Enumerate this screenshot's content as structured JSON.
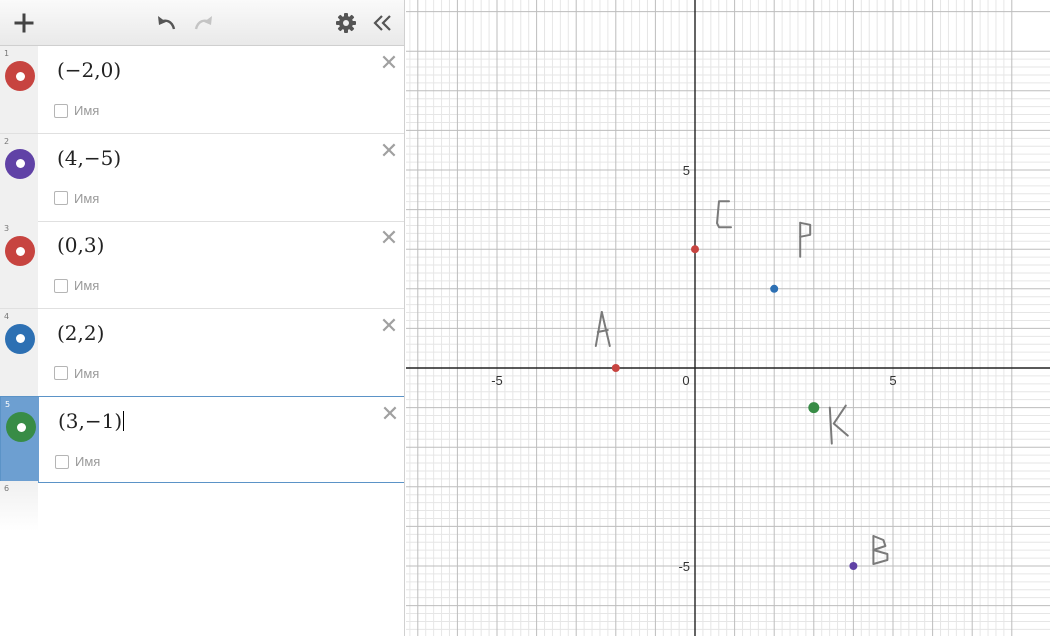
{
  "toolbar": {
    "add_icon": "plus-icon",
    "undo_icon": "undo-icon",
    "redo_icon": "redo-icon",
    "settings_icon": "gear-icon",
    "collapse_icon": "double-chevron-left-icon"
  },
  "expressions": [
    {
      "index": "1",
      "latex": "(−2,0)",
      "color": "#c74440",
      "label": "Имя"
    },
    {
      "index": "2",
      "latex": "(4,−5)",
      "color": "#6042a6",
      "label": "Имя"
    },
    {
      "index": "3",
      "latex": "(0,3)",
      "color": "#c74440",
      "label": "Имя"
    },
    {
      "index": "4",
      "latex": "(2,2)",
      "color": "#2d70b3",
      "label": "Имя"
    },
    {
      "index": "5",
      "latex": "(3,−1)",
      "color": "#388c46",
      "label": "Имя"
    }
  ],
  "empty_row_index": "6",
  "graph": {
    "x_tick_labels": [
      "-5",
      "0",
      "5"
    ],
    "y_tick_labels": [
      "5",
      "-5"
    ],
    "points": [
      {
        "x": -2,
        "y": 0,
        "color": "#c74440",
        "handwritten": "A"
      },
      {
        "x": 4,
        "y": -5,
        "color": "#6042a6",
        "handwritten": "B"
      },
      {
        "x": 0,
        "y": 3,
        "color": "#c74440",
        "handwritten": "C"
      },
      {
        "x": 2,
        "y": 2,
        "color": "#2d70b3",
        "handwritten": "P"
      },
      {
        "x": 3,
        "y": -1,
        "color": "#388c46",
        "handwritten": "K"
      }
    ]
  }
}
